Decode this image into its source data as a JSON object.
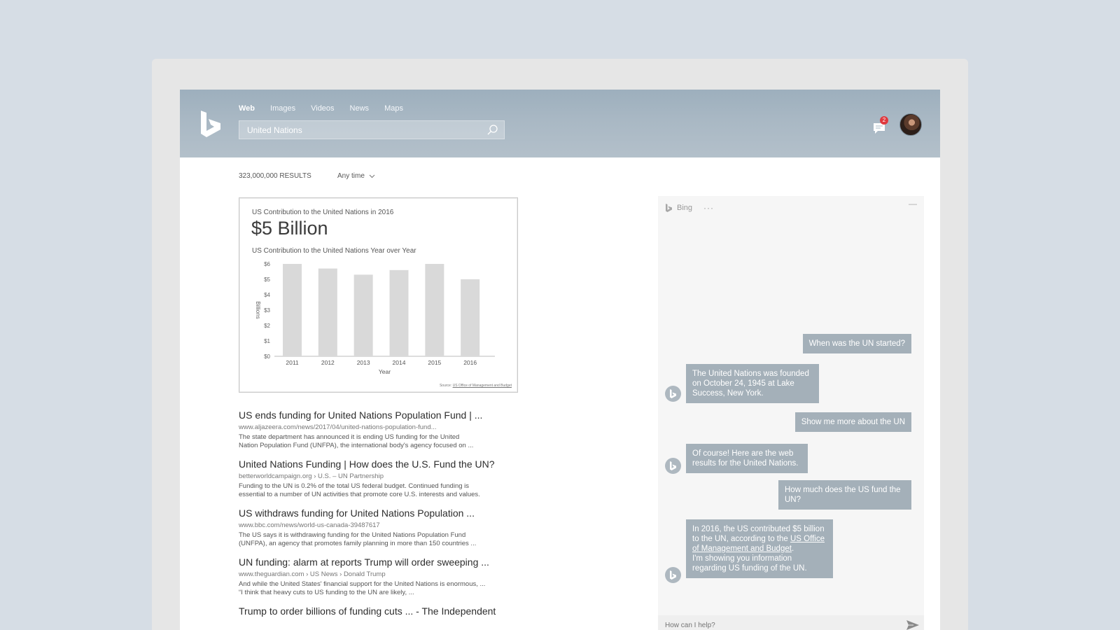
{
  "nav": {
    "tabs": [
      "Web",
      "Images",
      "Videos",
      "News",
      "Maps"
    ],
    "active": "Web"
  },
  "search": {
    "query": "United Nations"
  },
  "notifications": {
    "count": "2"
  },
  "results_meta": {
    "count": "323,000,000 RESULTS",
    "filter": "Any time"
  },
  "answer": {
    "title": "US Contribution to the United Nations in 2016",
    "amount": "$5 Billion",
    "subtitle": "US Contribution to the United Nations Year over Year",
    "source_prefix": "Source:",
    "source_link": "US Office of Management and Budget"
  },
  "chart_data": {
    "type": "bar",
    "categories": [
      "2011",
      "2012",
      "2013",
      "2014",
      "2015",
      "2016"
    ],
    "values": [
      6.0,
      5.7,
      5.3,
      5.6,
      6.0,
      5.0
    ],
    "yticks": [
      "$0",
      "$1",
      "$2",
      "$3",
      "$4",
      "$5",
      "$6"
    ],
    "ylim": [
      0,
      6
    ],
    "xlabel": "Year",
    "ylabel": "Billions",
    "grid": false,
    "bar_color": "#d9d9d9"
  },
  "results": [
    {
      "title": "US ends funding for United Nations Population Fund | ...",
      "url": "www.aljazeera.com/news/2017/04/united-nations-population-fund...",
      "snippet1": "The state department has announced it is ending US funding for the United",
      "snippet2": "Nation Population Fund (UNFPA), the international body's agency focused on ..."
    },
    {
      "title": "United Nations Funding | How does the U.S. Fund the UN?",
      "url": "betterworldcampaign.org › U.S. – UN Partnership",
      "snippet1": "Funding to the UN is 0.2% of the total US federal budget. Continued funding is",
      "snippet2": "essential to a number of UN activities that promote core U.S. interests and values."
    },
    {
      "title": "US withdraws funding for United Nations Population ...",
      "url": "www.bbc.com/news/world-us-canada-39487617",
      "snippet1": "The US says it is withdrawing funding for the United Nations Population Fund",
      "snippet2": "(UNFPA), an agency that promotes family planning in more than 150 countries ..."
    },
    {
      "title": "UN funding: alarm at reports Trump will order sweeping ...",
      "url": "www.theguardian.com › US News › Donald Trump",
      "snippet1": "And while the United States' financial support for the United Nations is enormous, ...",
      "snippet2": "“I think that heavy cuts to US funding to the UN are likely, ..."
    },
    {
      "title": "Trump to order billions of funding cuts ... - The Independent",
      "url": "",
      "snippet1": "",
      "snippet2": ""
    }
  ],
  "chat": {
    "name": "Bing",
    "more": "···",
    "minimize": "—",
    "messages": [
      {
        "from": "user",
        "text": "When was the UN started?"
      },
      {
        "from": "bot",
        "text": "The United Nations was founded on October 24, 1945 at Lake Success, New York."
      },
      {
        "from": "user",
        "text": "Show me more about the UN"
      },
      {
        "from": "bot",
        "text": "Of course! Here are the web results for the United Nations."
      },
      {
        "from": "user",
        "text": "How much does the US fund the UN?"
      },
      {
        "from": "bot",
        "text_before": "In 2016, the US contributed $5 billion to the UN, according to the ",
        "link": "US Office of Management and Budget",
        "text_after": ".",
        "text_line2": "I'm showing you information regarding US funding of the UN."
      }
    ],
    "input_placeholder": "How can I help?"
  }
}
